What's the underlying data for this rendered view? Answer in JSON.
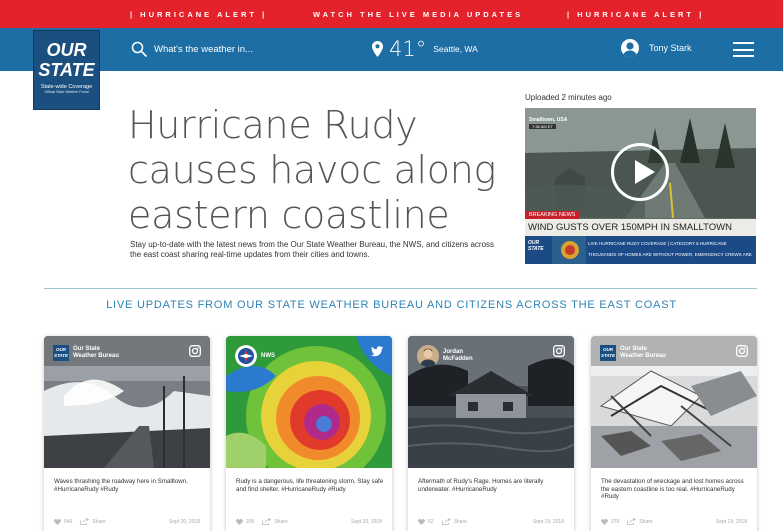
{
  "alert_bar": {
    "left": "| HURRICANE ALERT |",
    "center": "WATCH THE LIVE MEDIA UPDATES",
    "right": "| HURRICANE ALERT |",
    "color": "#e3222b"
  },
  "header": {
    "color": "#1c6ea4",
    "logo": {
      "line1": "OUR",
      "line2": "STATE",
      "tagline": "State-wide Coverage",
      "subtag": "Official State Weather Portal"
    },
    "search_placeholder": "What's the weather in...",
    "temperature": "41°",
    "city": "Seattle, WA",
    "user_name": "Tony Stark"
  },
  "hero": {
    "headline": "Hurricane Rudy causes havoc along eastern coastline",
    "subtext": "Stay up-to-date with the latest news from the Our State Weather Bureau, the NWS, and citizens across the east coast sharing real-time updates from their cities and towns.",
    "uploaded": "Uploaded 2 minutes ago",
    "video": {
      "location": "Smalltown, USA",
      "time": "7:36 AM ET",
      "breaking": "BREAKING NEWS",
      "ticker": "WIND GUSTS OVER 150MPH IN SMALLTOWN",
      "logo_line1": "OUR",
      "logo_line2": "STATE",
      "crawl1": "LIVE HURRICANE RUDY COVERAGE | CATEGORY 5 HURRICANE",
      "crawl2": "THOUSANDS OF HOMES ARE WITHOUT POWER, EMERGENCY CREWS ARE"
    }
  },
  "section_title": "LIVE UPDATES FROM OUR STATE WEATHER BUREAU AND CITIZENS ACROSS THE EAST COAST",
  "cards": [
    {
      "source_line1": "Our State",
      "source_line2": "Weather Bureau",
      "network": "instagram-icon",
      "caption": "Waves thrashing the roadway here in Smalltown. #HurricaneRudy #Rudy",
      "likes": "546",
      "share": "Share",
      "date": "Sept 20, 2018"
    },
    {
      "source_line1": "NWS",
      "source_line2": "",
      "network": "twitter-icon",
      "caption": "Rudy is a dangerous, life threatening storm. Stay safe and find shelter. #HurricaneRudy #Rudy",
      "likes": "206",
      "share": "Share",
      "date": "Sept 20, 2018"
    },
    {
      "source_line1": "Jordan",
      "source_line2": "McFadden",
      "network": "instagram-icon",
      "caption": "Aftermath of Rudy's Rage. Homes are literally underwater. #HurricaneRudy",
      "likes": "52",
      "share": "Share",
      "date": "Sept 19, 2018"
    },
    {
      "source_line1": "Our State",
      "source_line2": "Weather Bureau",
      "network": "instagram-icon",
      "caption": "The devastation of wreckage and lost homes across the eastern coastline is too real. #HurricaneRudy #Rudy",
      "likes": "378",
      "share": "Share",
      "date": "Sept 19, 2018"
    }
  ]
}
